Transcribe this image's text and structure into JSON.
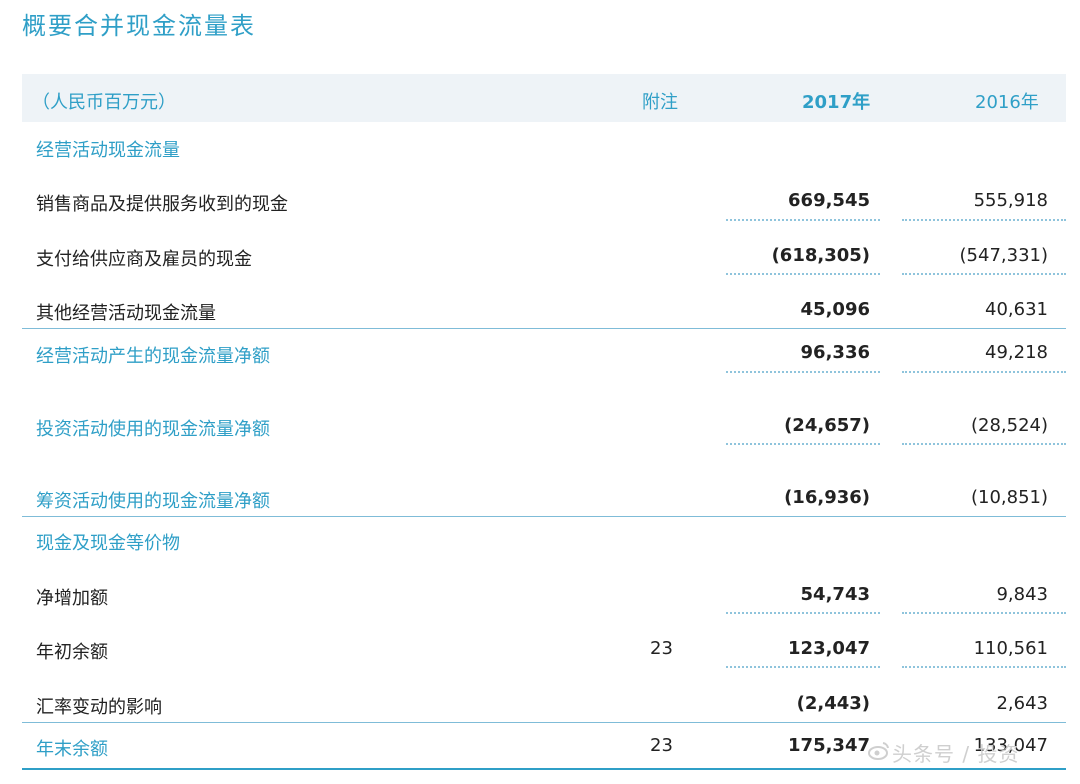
{
  "title": "概要合并现金流量表",
  "header": {
    "unit": "（人民币百万元）",
    "note": "附注",
    "y2017": "2017年",
    "y2016": "2016年"
  },
  "sections": {
    "operating": "经营活动现金流量",
    "cash_equiv": "现金及现金等价物"
  },
  "rows": [
    {
      "label": "销售商品及提供服务收到的现金",
      "note": "",
      "v2017": "669,545",
      "v2016": "555,918"
    },
    {
      "label": "支付给供应商及雇员的现金",
      "note": "",
      "v2017": "(618,305)",
      "v2016": "(547,331)"
    },
    {
      "label": "其他经营活动现金流量",
      "note": "",
      "v2017": "45,096",
      "v2016": "40,631"
    },
    {
      "label": "经营活动产生的现金流量净额",
      "note": "",
      "v2017": "96,336",
      "v2016": "49,218"
    },
    {
      "label": "投资活动使用的现金流量净额",
      "note": "",
      "v2017": "(24,657)",
      "v2016": "(28,524)"
    },
    {
      "label": "筹资活动使用的现金流量净额",
      "note": "",
      "v2017": "(16,936)",
      "v2016": "(10,851)"
    },
    {
      "label": "净增加额",
      "note": "",
      "v2017": "54,743",
      "v2016": "9,843"
    },
    {
      "label": "年初余额",
      "note": "23",
      "v2017": "123,047",
      "v2016": "110,561"
    },
    {
      "label": "汇率变动的影响",
      "note": "",
      "v2017": "(2,443)",
      "v2016": "2,643"
    },
    {
      "label": "年末余额",
      "note": "23",
      "v2017": "175,347",
      "v2016": "133,047"
    }
  ],
  "watermark": "头条号 / 投资"
}
